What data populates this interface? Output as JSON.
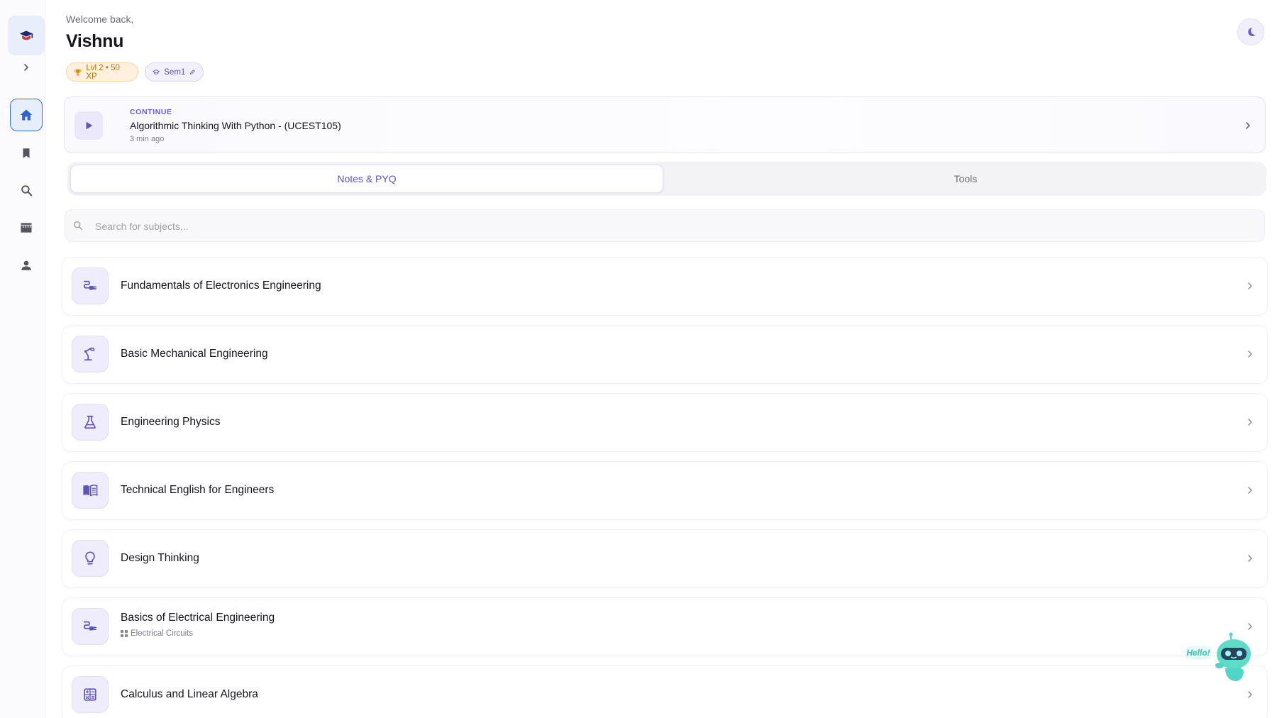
{
  "sidebar": {
    "logo_icon": "graduation-cap-icon",
    "expand_icon": "chevron-right-icon",
    "nav": [
      {
        "name": "home",
        "icon": "home-icon",
        "active": true
      },
      {
        "name": "bookmarks",
        "icon": "bookmark-icon",
        "active": false
      },
      {
        "name": "search",
        "icon": "search-icon",
        "active": false
      },
      {
        "name": "store",
        "icon": "store-icon",
        "active": false
      },
      {
        "name": "profile",
        "icon": "person-icon",
        "active": false
      }
    ]
  },
  "header": {
    "welcome": "Welcome back,",
    "username": "Vishnu",
    "xp_chip": "Lvl 2 • 50 XP",
    "sem_chip": "Sem1",
    "theme_icon": "moon-icon"
  },
  "continue": {
    "label": "CONTINUE",
    "title": "Algorithmic Thinking With Python - (UCEST105)",
    "time": "3 min ago"
  },
  "tabs": [
    {
      "label": "Notes & PYQ",
      "active": true
    },
    {
      "label": "Tools",
      "active": false
    }
  ],
  "search": {
    "placeholder": "Search for subjects..."
  },
  "subjects": [
    {
      "name": "Fundamentals of Electronics Engineering",
      "icon": "electrical-plug-icon",
      "tag": ""
    },
    {
      "name": "Basic Mechanical Engineering",
      "icon": "robotic-arm-icon",
      "tag": ""
    },
    {
      "name": "Engineering Physics",
      "icon": "flask-icon",
      "tag": ""
    },
    {
      "name": "Technical English for Engineers",
      "icon": "open-book-icon",
      "tag": ""
    },
    {
      "name": "Design Thinking",
      "icon": "lightbulb-icon",
      "tag": ""
    },
    {
      "name": "Basics of Electrical Engineering",
      "icon": "electrical-plug-icon",
      "tag": "Electrical Circuits"
    },
    {
      "name": "Calculus and Linear Algebra",
      "icon": "calculator-icon",
      "tag": ""
    }
  ],
  "mascot": {
    "greeting": "Hello!"
  },
  "colors": {
    "accent": "#5f54b6",
    "nav_active": "#3b6fd8",
    "xp": "#c2700c"
  }
}
